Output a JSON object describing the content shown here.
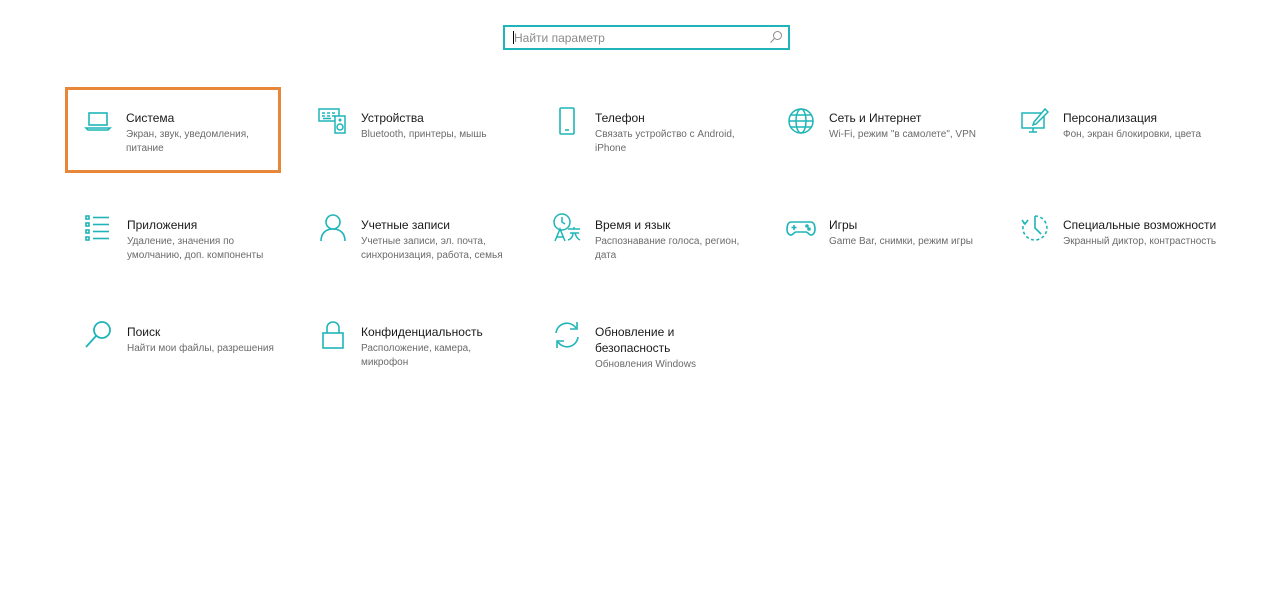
{
  "search": {
    "placeholder": "Найти параметр",
    "icon": "search-icon"
  },
  "accent_color": "#1fb5b8",
  "selection_color": "#e8873a",
  "tiles": [
    {
      "title": "Система",
      "desc": "Экран, звук, уведомления, питание",
      "icon": "laptop-icon"
    },
    {
      "title": "Устройства",
      "desc": "Bluetooth, принтеры, мышь",
      "icon": "devices-icon"
    },
    {
      "title": "Телефон",
      "desc": "Связать устройство с Android, iPhone",
      "icon": "phone-icon"
    },
    {
      "title": "Сеть и Интернет",
      "desc": "Wi-Fi, режим \"в самолете\", VPN",
      "icon": "globe-icon"
    },
    {
      "title": "Персонализация",
      "desc": "Фон, экран блокировки, цвета",
      "icon": "personalization-icon"
    },
    {
      "title": "Приложения",
      "desc": "Удаление, значения по умолчанию, доп. компоненты",
      "icon": "apps-list-icon"
    },
    {
      "title": "Учетные записи",
      "desc": "Учетные записи, эл. почта, синхронизация, работа, семья",
      "icon": "person-icon"
    },
    {
      "title": "Время и язык",
      "desc": "Распознавание голоса, регион, дата",
      "icon": "time-language-icon"
    },
    {
      "title": "Игры",
      "desc": "Game Bar, снимки, режим игры",
      "icon": "gamepad-icon"
    },
    {
      "title": "Специальные возможности",
      "desc": "Экранный диктор, контрастность",
      "icon": "ease-of-access-icon"
    },
    {
      "title": "Поиск",
      "desc": "Найти мои файлы, разрешения",
      "icon": "magnifier-icon"
    },
    {
      "title": "Конфиденциальность",
      "desc": "Расположение, камера, микрофон",
      "icon": "lock-icon"
    },
    {
      "title": "Обновление и безопасность",
      "desc": "Обновления Windows",
      "icon": "update-sync-icon"
    }
  ]
}
